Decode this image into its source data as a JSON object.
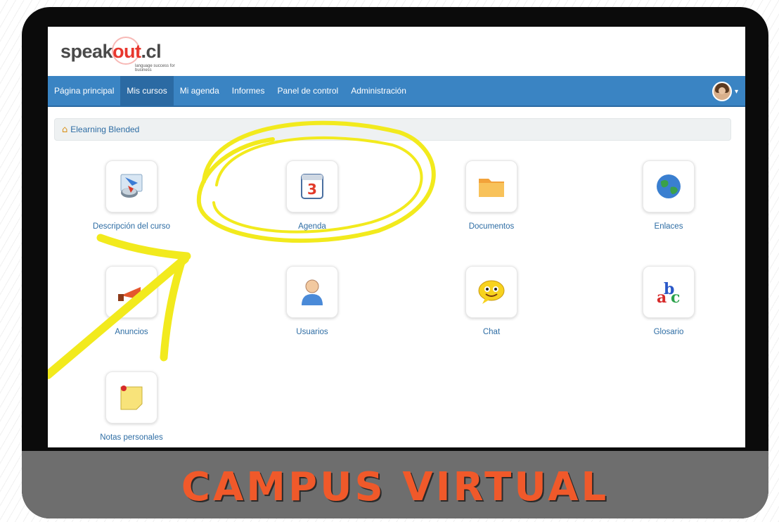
{
  "logo": {
    "word_start": "speak",
    "word_accent": "out",
    "word_end": ".cl",
    "tagline": "language success for business"
  },
  "nav": {
    "items": [
      {
        "label": "Página principal"
      },
      {
        "label": "Mis cursos"
      },
      {
        "label": "Mi agenda"
      },
      {
        "label": "Informes"
      },
      {
        "label": "Panel de control"
      },
      {
        "label": "Administración"
      }
    ],
    "active_index": 1
  },
  "breadcrumb": {
    "label": "Elearning Blended"
  },
  "tools": [
    {
      "label": "Descripción del curso",
      "icon": "course-description-icon"
    },
    {
      "label": "Agenda",
      "icon": "calendar-icon"
    },
    {
      "label": "Documentos",
      "icon": "folder-icon"
    },
    {
      "label": "Enlaces",
      "icon": "globe-icon"
    },
    {
      "label": "Anuncios",
      "icon": "announcements-icon"
    },
    {
      "label": "Usuarios",
      "icon": "user-icon"
    },
    {
      "label": "Chat",
      "icon": "chat-icon"
    },
    {
      "label": "Glosario",
      "icon": "glossary-icon"
    },
    {
      "label": "Notas personales",
      "icon": "sticky-note-icon"
    }
  ],
  "caption": "CAMPUS VIRTUAL",
  "colors": {
    "nav_bg": "#3a84c3",
    "nav_active": "#2b6aa3",
    "link": "#2e6da4",
    "brand_red": "#e8362d",
    "highlight_yellow": "#f2ea1d",
    "caption_orange": "#f0592a"
  }
}
